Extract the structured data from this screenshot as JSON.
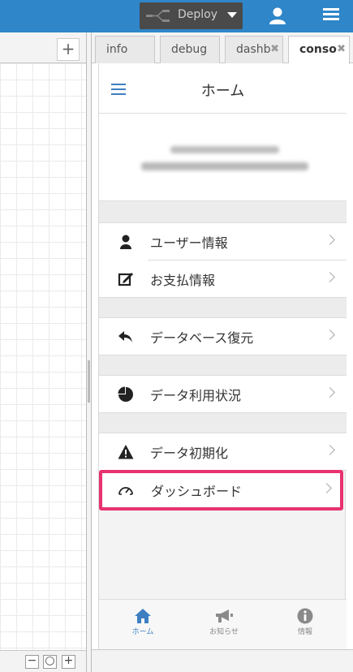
{
  "header": {
    "deploy_label": "Deploy",
    "colors": {
      "bar": "#2f86c9",
      "deploy_bg": "#4a4a4a"
    },
    "icons": [
      "flow-icon",
      "caret-down-icon",
      "user-icon",
      "menu-icon"
    ]
  },
  "workspace": {
    "add_label": "+",
    "zoom": {
      "out": "−",
      "reset": "○",
      "in": "+"
    }
  },
  "tabs": [
    {
      "label": "info"
    },
    {
      "label": "debug"
    },
    {
      "label": "dashb",
      "close": "✖"
    },
    {
      "label": "conso",
      "close": "✖"
    }
  ],
  "console": {
    "title": "ホーム",
    "menu_items": [
      {
        "label": "ユーザー情報",
        "icon": "user-icon"
      },
      {
        "label": "お支払情報",
        "icon": "edit-icon"
      },
      {
        "label": "データベース復元",
        "icon": "reply-icon"
      },
      {
        "label": "データ利用状況",
        "icon": "pie-chart-icon"
      },
      {
        "label": "データ初期化",
        "icon": "warning-icon"
      },
      {
        "label": "ダッシュボード",
        "icon": "dashboard-icon",
        "highlighted": true
      }
    ],
    "highlight_color": "#e8336f",
    "bottom_nav": [
      {
        "label": "ホーム",
        "icon": "home-icon",
        "active": true
      },
      {
        "label": "お知らせ",
        "icon": "megaphone-icon"
      },
      {
        "label": "情報",
        "icon": "info-icon"
      }
    ]
  }
}
